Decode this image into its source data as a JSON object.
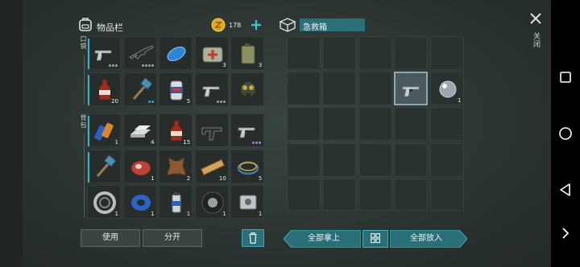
{
  "inventory": {
    "title": "物品栏",
    "coin_count": "178",
    "pocket_label": "口袋",
    "backpack_label": "背包",
    "pocket_items": [
      {
        "name": "pistol",
        "qty": "",
        "dots": 3,
        "dot_color": "#9aa4a6"
      },
      {
        "name": "assault-rifle",
        "qty": "",
        "dots": 4,
        "dot_color": "#9aa4a6"
      },
      {
        "name": "blue-fuel-cell",
        "qty": "",
        "dots": 0
      },
      {
        "name": "first-aid-kit",
        "qty": "3",
        "dots": 0
      },
      {
        "name": "jerrycan",
        "qty": "3",
        "dots": 0
      },
      {
        "name": "cola-bottle",
        "qty": "20",
        "dots": 0
      },
      {
        "name": "sledgehammer",
        "qty": "",
        "dots": 2,
        "dot_color": "#35a0d8"
      },
      {
        "name": "soda-can",
        "qty": "5",
        "dots": 0
      },
      {
        "name": "pistol",
        "qty": "",
        "dots": 3,
        "dot_color": "#9aa4a6"
      },
      {
        "name": "gas-mask",
        "qty": "",
        "dots": 0
      }
    ],
    "backpack_items": [
      {
        "name": "batteries",
        "qty": "1",
        "dots": 0
      },
      {
        "name": "metal-ingots",
        "qty": "4",
        "dots": 0
      },
      {
        "name": "cola-bottle",
        "qty": "15",
        "dots": 0
      },
      {
        "name": "submachine-gun",
        "qty": "",
        "dots": 0
      },
      {
        "name": "pistol",
        "qty": "",
        "dots": 3,
        "dot_color": "#9b86c8"
      },
      {
        "name": "sledgehammer",
        "qty": "",
        "dots": 0
      },
      {
        "name": "raw-meat",
        "qty": "1",
        "dots": 0
      },
      {
        "name": "animal-hide",
        "qty": "2",
        "dots": 0
      },
      {
        "name": "wooden-plank",
        "qty": "10",
        "dots": 0
      },
      {
        "name": "wire-coil",
        "qty": "5",
        "dots": 0
      },
      {
        "name": "bearing",
        "qty": "1",
        "dots": 0
      },
      {
        "name": "duct-tape",
        "qty": "1",
        "dots": 0
      },
      {
        "name": "spray-can",
        "qty": "1",
        "dots": 0
      },
      {
        "name": "tire",
        "qty": "1",
        "dots": 0
      },
      {
        "name": "engine-part",
        "qty": "1",
        "dots": 0
      }
    ],
    "use_label": "使用",
    "split_label": "分开"
  },
  "container": {
    "title": "急救箱",
    "items": [
      {
        "name": "pistol",
        "qty": "",
        "selected": true
      },
      {
        "name": "glass-orb",
        "qty": "1",
        "selected": false
      }
    ],
    "take_all_label": "全部拿上",
    "put_all_label": "全部放入"
  },
  "close_label": "关闭",
  "colors": {
    "accent": "#35b3c6",
    "teal_button": "#2a6f78",
    "coin": "#e0a81a"
  }
}
